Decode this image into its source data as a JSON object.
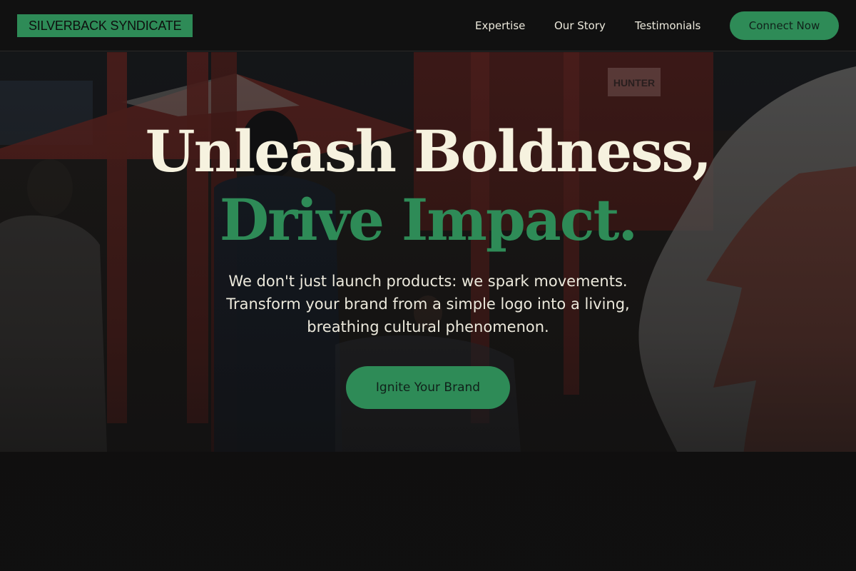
{
  "brand": {
    "logo_text": "SILVERBACK SYNDICATE"
  },
  "nav": {
    "links": [
      {
        "label": "Expertise"
      },
      {
        "label": "Our Story"
      },
      {
        "label": "Testimonials"
      }
    ],
    "cta_label": "Connect Now"
  },
  "hero": {
    "headline_line1": "Unleash Boldness,",
    "headline_line2": "Drive Impact.",
    "subtext": "We don't just launch products: we spark movements. Transform your brand from a simple logo into a living, breathing cultural phenomenon.",
    "cta_label": "Ignite Your Brand",
    "background_sign_text": "HUNTER"
  },
  "colors": {
    "accent": "#2e8b57",
    "headline_light": "#f6f2df",
    "header_bg": "#111111",
    "page_bg": "#141414"
  }
}
